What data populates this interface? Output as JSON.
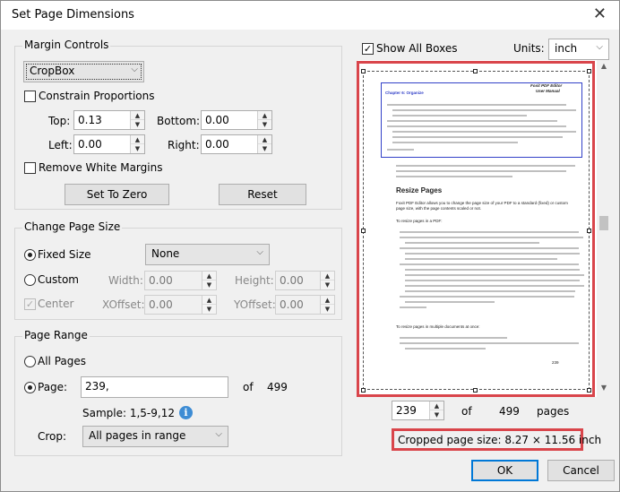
{
  "window": {
    "title": "Set Page Dimensions",
    "close_glyph": "✕"
  },
  "margin_controls": {
    "label": "Margin Controls",
    "box_type": "CropBox",
    "constrain_label": "Constrain Proportions",
    "top_label": "Top:",
    "top_value": "0.13",
    "bottom_label": "Bottom:",
    "bottom_value": "0.00",
    "left_label": "Left:",
    "left_value": "0.00",
    "right_label": "Right:",
    "right_value": "0.00",
    "remove_white_label": "Remove White Margins",
    "set_to_zero": "Set To Zero",
    "reset": "Reset"
  },
  "change_page_size": {
    "label": "Change Page Size",
    "fixed_size_label": "Fixed Size",
    "fixed_size_value": "None",
    "custom_label": "Custom",
    "width_label": "Width:",
    "width_value": "0.00",
    "height_label": "Height:",
    "height_value": "0.00",
    "center_label": "Center",
    "xoffset_label": "XOffset:",
    "xoffset_value": "0.00",
    "yoffset_label": "YOffset:",
    "yoffset_value": "0.00"
  },
  "page_range": {
    "label": "Page Range",
    "all_pages_label": "All Pages",
    "page_label": "Page:",
    "page_value": "239,",
    "of_label": "of",
    "total": "499",
    "sample": "Sample: 1,5-9,12",
    "crop_label": "Crop:",
    "crop_value": "All pages in range"
  },
  "preview": {
    "show_all_boxes_label": "Show All Boxes",
    "units_label": "Units:",
    "units_value": "inch",
    "page_number": "239",
    "of_label": "of",
    "total_pages": "499",
    "pages_label": "pages",
    "cropped_size": "Cropped page size:  8.27 × 11.56  inch",
    "doc": {
      "header_right_1": "Foxit  PDF Editor",
      "header_right_2": "User Manual",
      "chapter": "Chapter 6: Organize",
      "heading": "Resize Pages",
      "intro": "Foxit PDF Editor allows you to change the page size of your PDF to a standard (fixed) or custom page size, with the page contents scaled or not.",
      "sub1": "To resize pages in a PDF:",
      "sub2": "To resize pages in multiple documents at once:",
      "footer_page": "239"
    }
  },
  "buttons": {
    "ok": "OK",
    "cancel": "Cancel"
  },
  "colors": {
    "highlight": "#d9454b",
    "accent": "#0078d7",
    "doc_header_border": "#3341c8"
  }
}
